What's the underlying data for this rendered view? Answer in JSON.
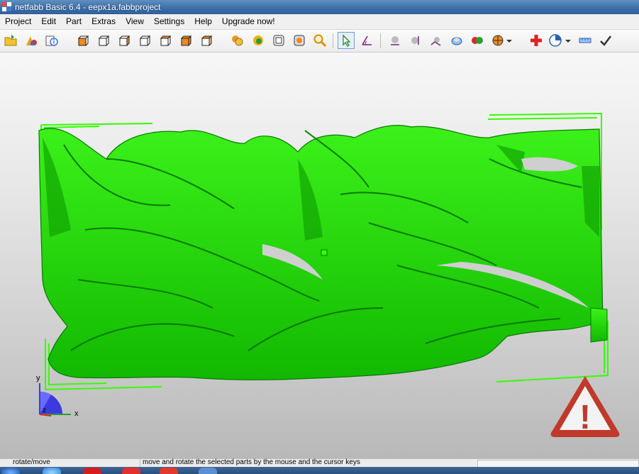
{
  "window": {
    "title": "netfabb Basic 6.4 - eepx1a.fabbproject"
  },
  "menu": {
    "items": [
      "Project",
      "Edit",
      "Part",
      "Extras",
      "View",
      "Settings",
      "Help",
      "Upgrade now!"
    ]
  },
  "toolbar": {
    "buttons": [
      "open-icon",
      "add-part-icon",
      "part-info-icon",
      "view-front-icon",
      "view-back-icon",
      "view-left-icon",
      "view-right-icon",
      "view-top-icon",
      "view-bottom-icon",
      "view-iso-icon",
      "shading-icon",
      "solid-icon",
      "wireframe-icon",
      "translucent-icon",
      "zoom-icon",
      "select-tool-icon",
      "move-rotate-tool-icon",
      "measure-point-icon",
      "measure-edge-icon",
      "measure-distance-icon",
      "cut-icon",
      "split-icon",
      "section-icon",
      "repair-icon",
      "analysis-icon",
      "ruler-icon",
      "apply-check-icon"
    ]
  },
  "viewport": {
    "axes": {
      "x": "x",
      "y": "y",
      "z": "z"
    },
    "model_color": "#22dd00",
    "bbox_color": "#33ff00",
    "warning": {
      "symbol": "!",
      "color": "#c0392b"
    }
  },
  "status": {
    "mode": "rotate/move",
    "hint": "move and rotate the selected parts by the mouse and the cursor keys"
  },
  "colors": {
    "title_bar": "#3c6ea8",
    "accent": "#6a9fd6",
    "model": "#22dd00"
  }
}
